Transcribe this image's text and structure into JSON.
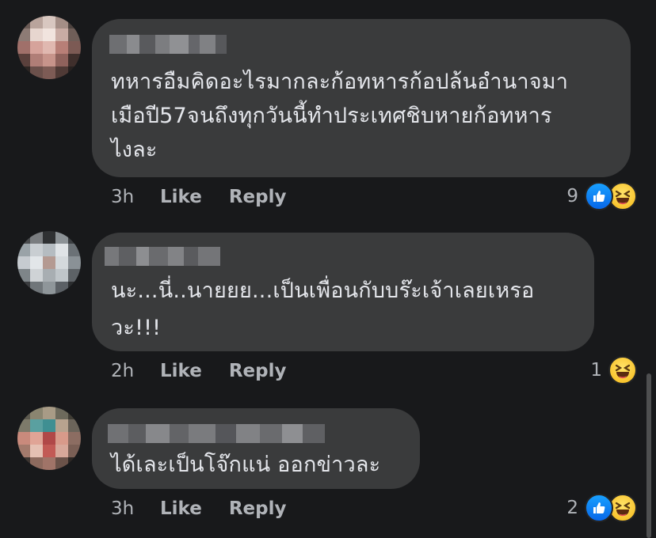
{
  "comments": [
    {
      "author": "",
      "lines": [
        "ทหารอืมคิดอะไรมากละก้อทหารก้อปล้นอำนาจมา",
        "เมือปี57จนถึงทุกวันนี้ทำประเทศชิบหายก้อทหาร",
        "ไงละ"
      ],
      "time": "3h",
      "like_label": "Like",
      "reply_label": "Reply",
      "reaction_count": "9",
      "reactions": [
        "like-icon",
        "haha-icon"
      ]
    },
    {
      "author": "",
      "lines": [
        "นะ...นี่..นายยย...เป็นเพื่อนกับบร๊ะเจ้าเลยเหรอ",
        "วะ!!!"
      ],
      "time": "2h",
      "like_label": "Like",
      "reply_label": "Reply",
      "reaction_count": "1",
      "reactions": [
        "haha-icon"
      ]
    },
    {
      "author": "",
      "lines": [
        "ได้เละเป็นโจ๊กแน่ ออกข่าวละ"
      ],
      "time": "3h",
      "like_label": "Like",
      "reply_label": "Reply",
      "reaction_count": "2",
      "reactions": [
        "like-icon",
        "haha-icon"
      ]
    }
  ],
  "colors": {
    "background": "#18191b",
    "bubble": "#3a3b3c",
    "text": "#e4e6eb",
    "meta": "#b0b3b8",
    "like_blue": "#1877f2",
    "haha_yellow": "#f7c444"
  }
}
